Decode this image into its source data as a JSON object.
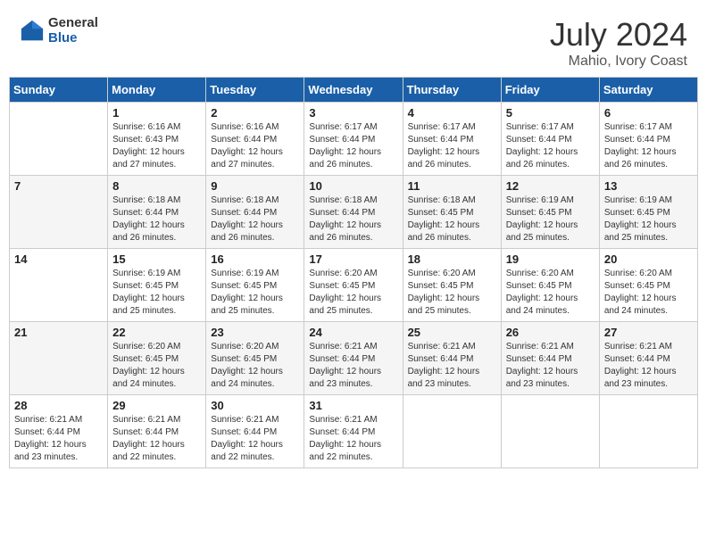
{
  "header": {
    "logo_general": "General",
    "logo_blue": "Blue",
    "month_year": "July 2024",
    "location": "Mahio, Ivory Coast"
  },
  "days_of_week": [
    "Sunday",
    "Monday",
    "Tuesday",
    "Wednesday",
    "Thursday",
    "Friday",
    "Saturday"
  ],
  "weeks": [
    [
      {
        "day": "",
        "info": ""
      },
      {
        "day": "1",
        "info": "Sunrise: 6:16 AM\nSunset: 6:43 PM\nDaylight: 12 hours\nand 27 minutes."
      },
      {
        "day": "2",
        "info": "Sunrise: 6:16 AM\nSunset: 6:44 PM\nDaylight: 12 hours\nand 27 minutes."
      },
      {
        "day": "3",
        "info": "Sunrise: 6:17 AM\nSunset: 6:44 PM\nDaylight: 12 hours\nand 26 minutes."
      },
      {
        "day": "4",
        "info": "Sunrise: 6:17 AM\nSunset: 6:44 PM\nDaylight: 12 hours\nand 26 minutes."
      },
      {
        "day": "5",
        "info": "Sunrise: 6:17 AM\nSunset: 6:44 PM\nDaylight: 12 hours\nand 26 minutes."
      },
      {
        "day": "6",
        "info": "Sunrise: 6:17 AM\nSunset: 6:44 PM\nDaylight: 12 hours\nand 26 minutes."
      }
    ],
    [
      {
        "day": "7",
        "info": ""
      },
      {
        "day": "8",
        "info": "Sunrise: 6:18 AM\nSunset: 6:44 PM\nDaylight: 12 hours\nand 26 minutes."
      },
      {
        "day": "9",
        "info": "Sunrise: 6:18 AM\nSunset: 6:44 PM\nDaylight: 12 hours\nand 26 minutes."
      },
      {
        "day": "10",
        "info": "Sunrise: 6:18 AM\nSunset: 6:44 PM\nDaylight: 12 hours\nand 26 minutes."
      },
      {
        "day": "11",
        "info": "Sunrise: 6:18 AM\nSunset: 6:45 PM\nDaylight: 12 hours\nand 26 minutes."
      },
      {
        "day": "12",
        "info": "Sunrise: 6:19 AM\nSunset: 6:45 PM\nDaylight: 12 hours\nand 25 minutes."
      },
      {
        "day": "13",
        "info": "Sunrise: 6:19 AM\nSunset: 6:45 PM\nDaylight: 12 hours\nand 25 minutes."
      }
    ],
    [
      {
        "day": "14",
        "info": ""
      },
      {
        "day": "15",
        "info": "Sunrise: 6:19 AM\nSunset: 6:45 PM\nDaylight: 12 hours\nand 25 minutes."
      },
      {
        "day": "16",
        "info": "Sunrise: 6:19 AM\nSunset: 6:45 PM\nDaylight: 12 hours\nand 25 minutes."
      },
      {
        "day": "17",
        "info": "Sunrise: 6:20 AM\nSunset: 6:45 PM\nDaylight: 12 hours\nand 25 minutes."
      },
      {
        "day": "18",
        "info": "Sunrise: 6:20 AM\nSunset: 6:45 PM\nDaylight: 12 hours\nand 25 minutes."
      },
      {
        "day": "19",
        "info": "Sunrise: 6:20 AM\nSunset: 6:45 PM\nDaylight: 12 hours\nand 24 minutes."
      },
      {
        "day": "20",
        "info": "Sunrise: 6:20 AM\nSunset: 6:45 PM\nDaylight: 12 hours\nand 24 minutes."
      }
    ],
    [
      {
        "day": "21",
        "info": ""
      },
      {
        "day": "22",
        "info": "Sunrise: 6:20 AM\nSunset: 6:45 PM\nDaylight: 12 hours\nand 24 minutes."
      },
      {
        "day": "23",
        "info": "Sunrise: 6:20 AM\nSunset: 6:45 PM\nDaylight: 12 hours\nand 24 minutes."
      },
      {
        "day": "24",
        "info": "Sunrise: 6:21 AM\nSunset: 6:44 PM\nDaylight: 12 hours\nand 23 minutes."
      },
      {
        "day": "25",
        "info": "Sunrise: 6:21 AM\nSunset: 6:44 PM\nDaylight: 12 hours\nand 23 minutes."
      },
      {
        "day": "26",
        "info": "Sunrise: 6:21 AM\nSunset: 6:44 PM\nDaylight: 12 hours\nand 23 minutes."
      },
      {
        "day": "27",
        "info": "Sunrise: 6:21 AM\nSunset: 6:44 PM\nDaylight: 12 hours\nand 23 minutes."
      }
    ],
    [
      {
        "day": "28",
        "info": "Sunrise: 6:21 AM\nSunset: 6:44 PM\nDaylight: 12 hours\nand 23 minutes."
      },
      {
        "day": "29",
        "info": "Sunrise: 6:21 AM\nSunset: 6:44 PM\nDaylight: 12 hours\nand 22 minutes."
      },
      {
        "day": "30",
        "info": "Sunrise: 6:21 AM\nSunset: 6:44 PM\nDaylight: 12 hours\nand 22 minutes."
      },
      {
        "day": "31",
        "info": "Sunrise: 6:21 AM\nSunset: 6:44 PM\nDaylight: 12 hours\nand 22 minutes."
      },
      {
        "day": "",
        "info": ""
      },
      {
        "day": "",
        "info": ""
      },
      {
        "day": "",
        "info": ""
      }
    ]
  ]
}
